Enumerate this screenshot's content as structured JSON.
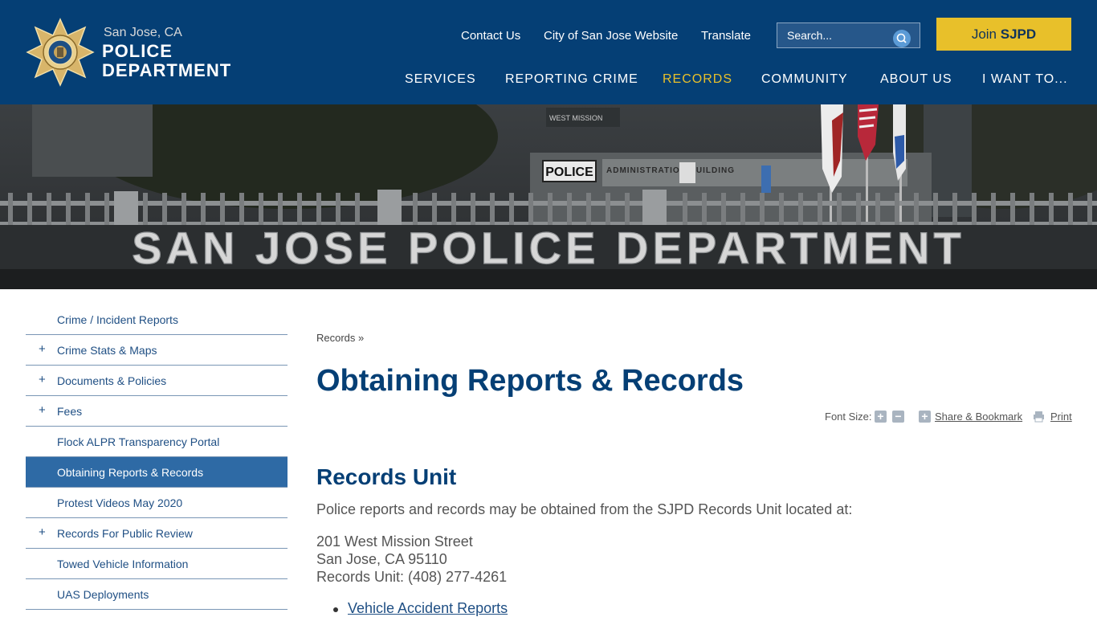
{
  "header": {
    "city": "San Jose, CA",
    "dept_line1": "POLICE",
    "dept_line2": "DEPARTMENT",
    "utility_links": [
      "Contact Us",
      "City of San Jose Website",
      "Translate"
    ],
    "search": {
      "placeholder": "Search..."
    },
    "join": {
      "prefix": "Join ",
      "bold": "SJPD"
    },
    "nav": [
      {
        "label": "SERVICES",
        "active": false
      },
      {
        "label": "REPORTING CRIME",
        "active": false
      },
      {
        "label": "RECORDS",
        "active": true
      },
      {
        "label": "COMMUNITY",
        "active": false
      },
      {
        "label": "ABOUT US",
        "active": false
      },
      {
        "label": "I WANT TO...",
        "active": false
      }
    ],
    "colors": {
      "background": "#053f75",
      "accent": "#e8c02a"
    }
  },
  "hero": {
    "sign_text": "SAN JOSE POLICE DEPARTMENT",
    "building_sign": "POLICE",
    "building_text": "ADMINISTRATION BUILDING",
    "street_sign": "WEST MISSION"
  },
  "sidebar": {
    "items": [
      {
        "label": "Crime / Incident Reports",
        "expandable": false,
        "active": false
      },
      {
        "label": "Crime Stats & Maps",
        "expandable": true,
        "active": false
      },
      {
        "label": "Documents & Policies",
        "expandable": true,
        "active": false
      },
      {
        "label": "Fees",
        "expandable": true,
        "active": false
      },
      {
        "label": "Flock ALPR Transparency Portal",
        "expandable": false,
        "active": false
      },
      {
        "label": "Obtaining Reports & Records",
        "expandable": false,
        "active": true
      },
      {
        "label": "Protest Videos May 2020",
        "expandable": false,
        "active": false
      },
      {
        "label": "Records For Public Review",
        "expandable": true,
        "active": false
      },
      {
        "label": "Towed Vehicle Information",
        "expandable": false,
        "active": false
      },
      {
        "label": "UAS Deployments",
        "expandable": false,
        "active": false
      }
    ],
    "expand_symbol": "+"
  },
  "main": {
    "breadcrumb": "Records »",
    "title": "Obtaining Reports & Records",
    "tools": {
      "font_size_label": "Font Size:",
      "share_label": "Share & Bookmark",
      "print_label": "Print"
    },
    "section_title": "Records Unit",
    "intro": "Police reports and records may be obtained from the SJPD Records Unit located at:",
    "address": [
      "201 West Mission Street",
      "San Jose, CA 95110",
      "Records Unit: (408) 277-4261"
    ],
    "links": [
      "Vehicle Accident Reports"
    ]
  }
}
